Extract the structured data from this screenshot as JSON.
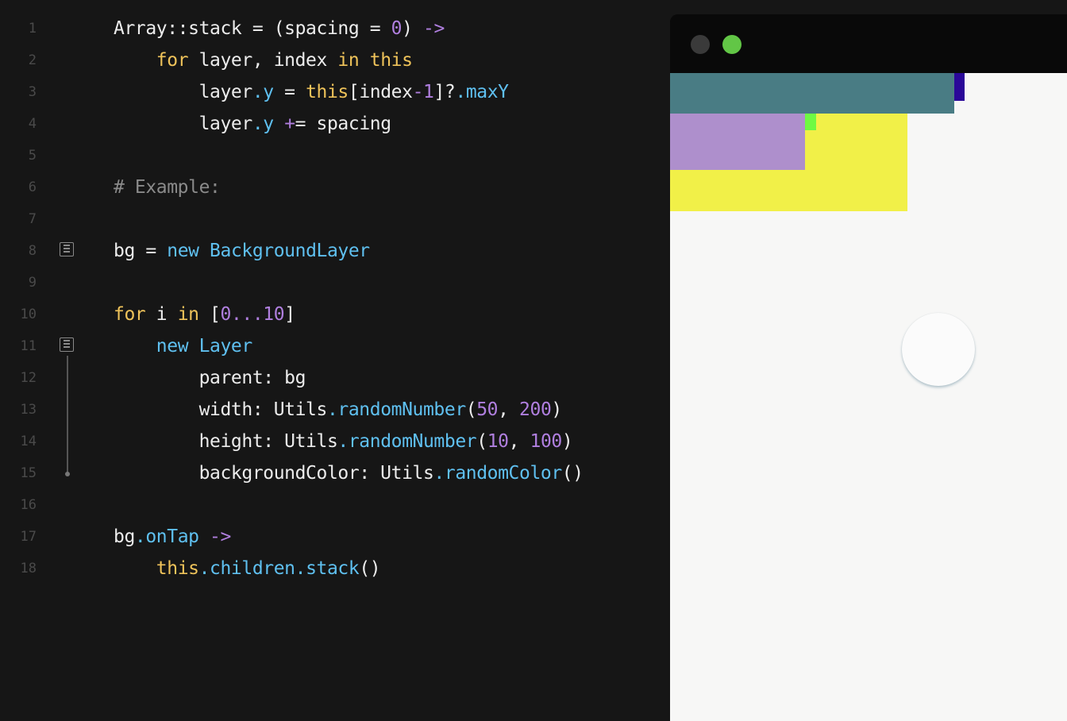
{
  "editor": {
    "lines": [
      {
        "num": "1",
        "tokens": [
          {
            "t": "Array::stack = (spacing = ",
            "c": "txt"
          },
          {
            "t": "0",
            "c": "pur"
          },
          {
            "t": ") ",
            "c": "txt"
          },
          {
            "t": "->",
            "c": "pur"
          }
        ]
      },
      {
        "num": "2",
        "tokens": [
          {
            "t": "    ",
            "c": "txt"
          },
          {
            "t": "for",
            "c": "kw"
          },
          {
            "t": " layer, index ",
            "c": "txt"
          },
          {
            "t": "in",
            "c": "kw"
          },
          {
            "t": " ",
            "c": "txt"
          },
          {
            "t": "this",
            "c": "kw"
          }
        ]
      },
      {
        "num": "3",
        "tokens": [
          {
            "t": "        layer",
            "c": "txt"
          },
          {
            "t": ".y",
            "c": "blu"
          },
          {
            "t": " = ",
            "c": "txt"
          },
          {
            "t": "this",
            "c": "kw"
          },
          {
            "t": "[index",
            "c": "txt"
          },
          {
            "t": "-",
            "c": "pur"
          },
          {
            "t": "1",
            "c": "pur"
          },
          {
            "t": "]?",
            "c": "txt"
          },
          {
            "t": ".maxY",
            "c": "blu"
          }
        ]
      },
      {
        "num": "4",
        "tokens": [
          {
            "t": "        layer",
            "c": "txt"
          },
          {
            "t": ".y",
            "c": "blu"
          },
          {
            "t": " ",
            "c": "txt"
          },
          {
            "t": "+",
            "c": "pur"
          },
          {
            "t": "= spacing",
            "c": "txt"
          }
        ]
      },
      {
        "num": "5",
        "tokens": []
      },
      {
        "num": "6",
        "tokens": [
          {
            "t": "# Example:",
            "c": "cmt"
          }
        ]
      },
      {
        "num": "7",
        "tokens": []
      },
      {
        "num": "8",
        "tokens": [
          {
            "t": "bg = ",
            "c": "txt"
          },
          {
            "t": "new",
            "c": "blu"
          },
          {
            "t": " ",
            "c": "txt"
          },
          {
            "t": "BackgroundLayer",
            "c": "blu"
          }
        ],
        "fold": true
      },
      {
        "num": "9",
        "tokens": []
      },
      {
        "num": "10",
        "tokens": [
          {
            "t": "for",
            "c": "kw"
          },
          {
            "t": " i ",
            "c": "txt"
          },
          {
            "t": "in",
            "c": "kw"
          },
          {
            "t": " [",
            "c": "txt"
          },
          {
            "t": "0...10",
            "c": "pur"
          },
          {
            "t": "]",
            "c": "txt"
          }
        ]
      },
      {
        "num": "11",
        "tokens": [
          {
            "t": "    ",
            "c": "txt"
          },
          {
            "t": "new",
            "c": "blu"
          },
          {
            "t": " ",
            "c": "txt"
          },
          {
            "t": "Layer",
            "c": "blu"
          }
        ],
        "fold": true
      },
      {
        "num": "12",
        "tokens": [
          {
            "t": "        parent: bg",
            "c": "txt"
          }
        ]
      },
      {
        "num": "13",
        "tokens": [
          {
            "t": "        width: Utils",
            "c": "txt"
          },
          {
            "t": ".randomNumber",
            "c": "blu"
          },
          {
            "t": "(",
            "c": "txt"
          },
          {
            "t": "50",
            "c": "pur"
          },
          {
            "t": ", ",
            "c": "txt"
          },
          {
            "t": "200",
            "c": "pur"
          },
          {
            "t": ")",
            "c": "txt"
          }
        ]
      },
      {
        "num": "14",
        "tokens": [
          {
            "t": "        height: Utils",
            "c": "txt"
          },
          {
            "t": ".randomNumber",
            "c": "blu"
          },
          {
            "t": "(",
            "c": "txt"
          },
          {
            "t": "10",
            "c": "pur"
          },
          {
            "t": ", ",
            "c": "txt"
          },
          {
            "t": "100",
            "c": "pur"
          },
          {
            "t": ")",
            "c": "txt"
          }
        ]
      },
      {
        "num": "15",
        "tokens": [
          {
            "t": "        backgroundColor: Utils",
            "c": "txt"
          },
          {
            "t": ".randomColor",
            "c": "blu"
          },
          {
            "t": "()",
            "c": "txt"
          }
        ]
      },
      {
        "num": "16",
        "tokens": []
      },
      {
        "num": "17",
        "tokens": [
          {
            "t": "bg",
            "c": "txt"
          },
          {
            "t": ".onTap",
            "c": "blu"
          },
          {
            "t": " ",
            "c": "txt"
          },
          {
            "t": "->",
            "c": "pur"
          }
        ]
      },
      {
        "num": "18",
        "tokens": [
          {
            "t": "    ",
            "c": "txt"
          },
          {
            "t": "this",
            "c": "kw"
          },
          {
            "t": ".children",
            "c": "blu"
          },
          {
            "t": ".stack",
            "c": "blu"
          },
          {
            "t": "()",
            "c": "txt"
          }
        ]
      }
    ]
  },
  "preview": {
    "window_buttons": [
      {
        "name": "close",
        "color": "#3a3a3a"
      },
      {
        "name": "zoom",
        "color": "#62c646"
      }
    ],
    "canvas_background": "#f7f7f6",
    "layer_colors": [
      "#497c84",
      "#2a0898",
      "#ae8fcc",
      "#6efa43",
      "#f1f048"
    ]
  }
}
